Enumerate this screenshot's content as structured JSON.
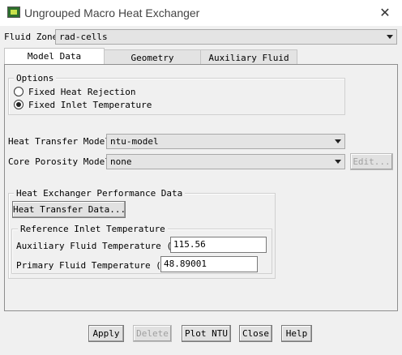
{
  "window": {
    "title": "Ungrouped Macro Heat Exchanger",
    "close_glyph": "✕"
  },
  "fluid_zone": {
    "label": "Fluid Zone",
    "value": "rad-cells"
  },
  "tabs": [
    {
      "label": "Model Data",
      "active": true
    },
    {
      "label": "Geometry",
      "active": false
    },
    {
      "label": "Auxiliary Fluid",
      "active": false
    }
  ],
  "options": {
    "title": "Options",
    "radios": [
      {
        "label": "Fixed Heat Rejection",
        "checked": false
      },
      {
        "label": "Fixed Inlet Temperature",
        "checked": true
      }
    ]
  },
  "heat_transfer_model": {
    "label": "Heat Transfer Model",
    "value": "ntu-model"
  },
  "core_porosity_model": {
    "label": "Core Porosity Model",
    "value": "none",
    "edit_label": "Edit..."
  },
  "performance": {
    "title": "Heat Exchanger Performance Data",
    "button_label": "Heat Transfer Data...",
    "reference": {
      "title": "Reference Inlet Temperature",
      "aux_label": "Auxiliary Fluid Temperature (c)",
      "aux_value": "115.56",
      "primary_label": "Primary Fluid Temperature (c)",
      "primary_value": "48.89001"
    }
  },
  "buttons": {
    "apply": "Apply",
    "delete": "Delete",
    "plot_ntu": "Plot NTU",
    "close": "Close",
    "help": "Help"
  },
  "icons": {
    "app": "heat-exchanger-app-icon",
    "close": "close-icon",
    "dropdown": "chevron-down-icon"
  }
}
